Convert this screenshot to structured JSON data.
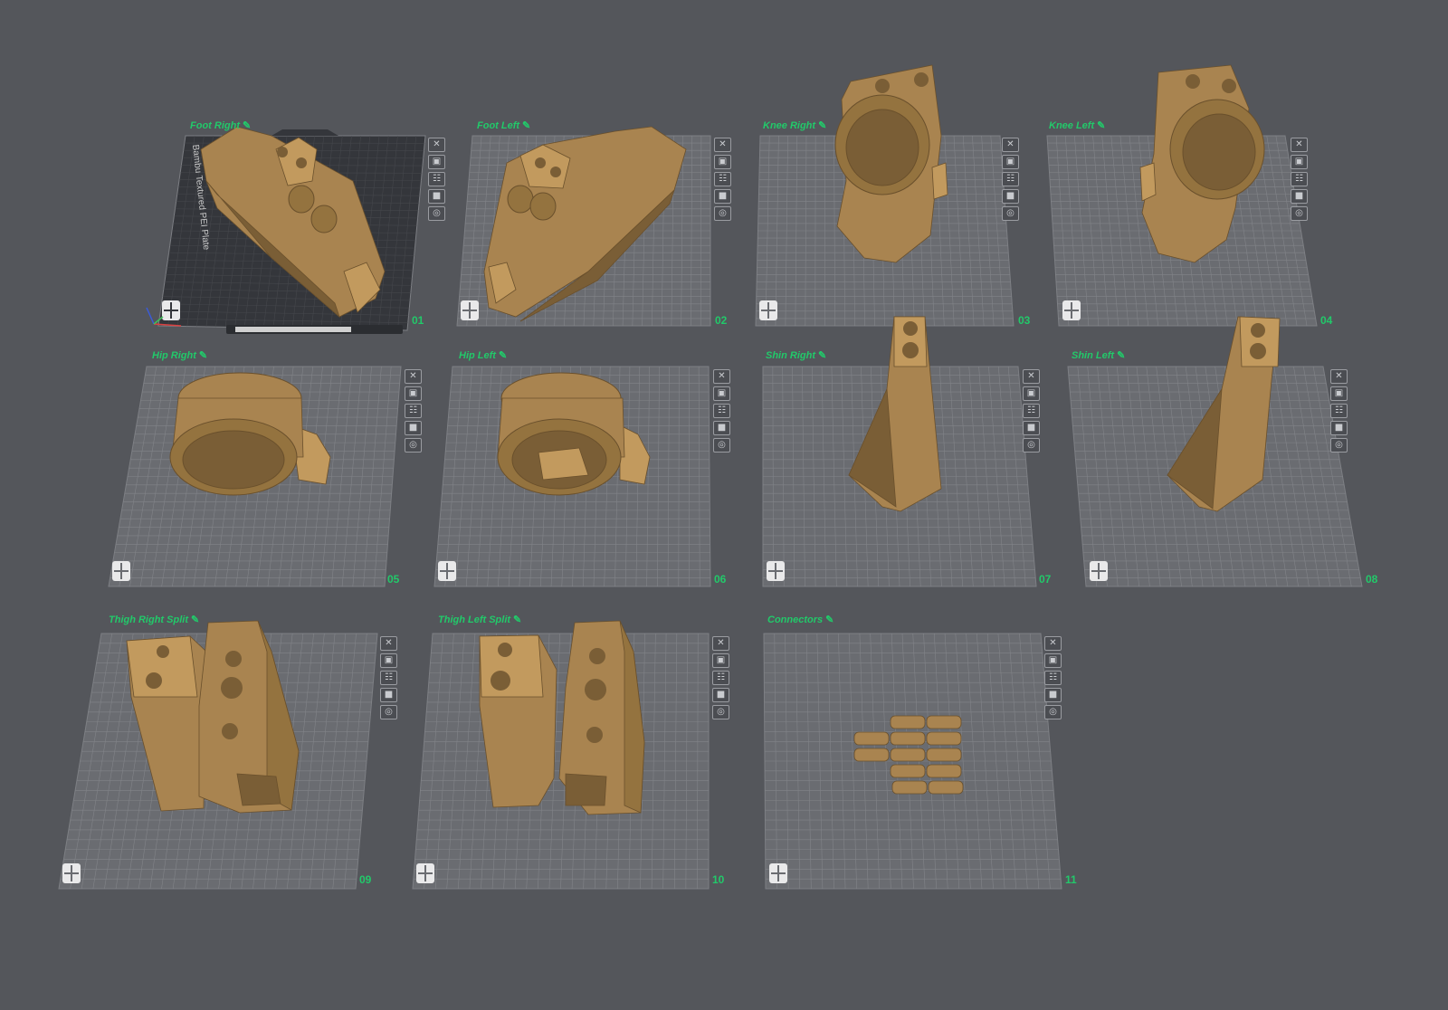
{
  "colors": {
    "background": "#54565b",
    "plate_fill": "#6a6c71",
    "plate_grid": "#8a8c91",
    "selected_plate_fill": "#34363b",
    "label_green": "#22c96a",
    "model_tan": "#a98450"
  },
  "plate_tool_icons": [
    "close-icon",
    "arrange-icon",
    "orient-icon",
    "lock-icon",
    "settings-icon"
  ],
  "plates": [
    {
      "id": "01",
      "number": "01",
      "name": "Foot Right",
      "selected": true,
      "texture_text": "Bambu Textured PEI Plate",
      "model": "foot-right"
    },
    {
      "id": "02",
      "number": "02",
      "name": "Foot Left",
      "selected": false,
      "model": "foot-left"
    },
    {
      "id": "03",
      "number": "03",
      "name": "Knee Right",
      "selected": false,
      "model": "knee-right"
    },
    {
      "id": "04",
      "number": "04",
      "name": "Knee Left",
      "selected": false,
      "model": "knee-left"
    },
    {
      "id": "05",
      "number": "05",
      "name": "Hip Right",
      "selected": false,
      "model": "hip-right"
    },
    {
      "id": "06",
      "number": "06",
      "name": "Hip Left",
      "selected": false,
      "model": "hip-left"
    },
    {
      "id": "07",
      "number": "07",
      "name": "Shin Right",
      "selected": false,
      "model": "shin-right"
    },
    {
      "id": "08",
      "number": "08",
      "name": "Shin Left",
      "selected": false,
      "model": "shin-left"
    },
    {
      "id": "09",
      "number": "09",
      "name": "Thigh Right Split",
      "selected": false,
      "model": "thigh-right"
    },
    {
      "id": "10",
      "number": "10",
      "name": "Thigh Left Split",
      "selected": false,
      "model": "thigh-left"
    },
    {
      "id": "11",
      "number": "11",
      "name": "Connectors",
      "selected": false,
      "model": "connectors"
    }
  ]
}
